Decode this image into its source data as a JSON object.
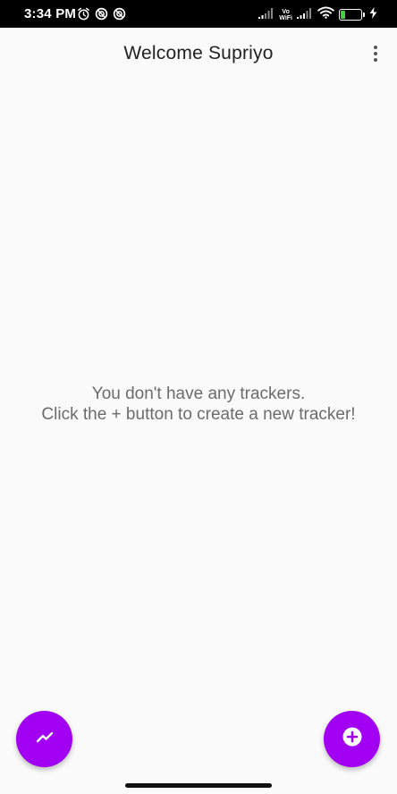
{
  "status_bar": {
    "time": "3:34 PM",
    "left_icons": [
      "alarm-icon",
      "data-saver-icon",
      "data-saver-icon"
    ],
    "volte_line1": "Vo",
    "volte_line2": "WiFi",
    "battery_level": "30",
    "battery_fill_percent": 30,
    "battery_fill_color": "#3fd13f"
  },
  "app_bar": {
    "title": "Welcome Supriyo",
    "menu_icon": "more-vert-icon"
  },
  "empty_state": {
    "line1": "You don't have any trackers.",
    "line2": "Click the + button to create a new tracker!"
  },
  "fabs": {
    "left_icon": "trending-up-icon",
    "right_icon": "add-circle-icon",
    "color": "#a100f2"
  }
}
